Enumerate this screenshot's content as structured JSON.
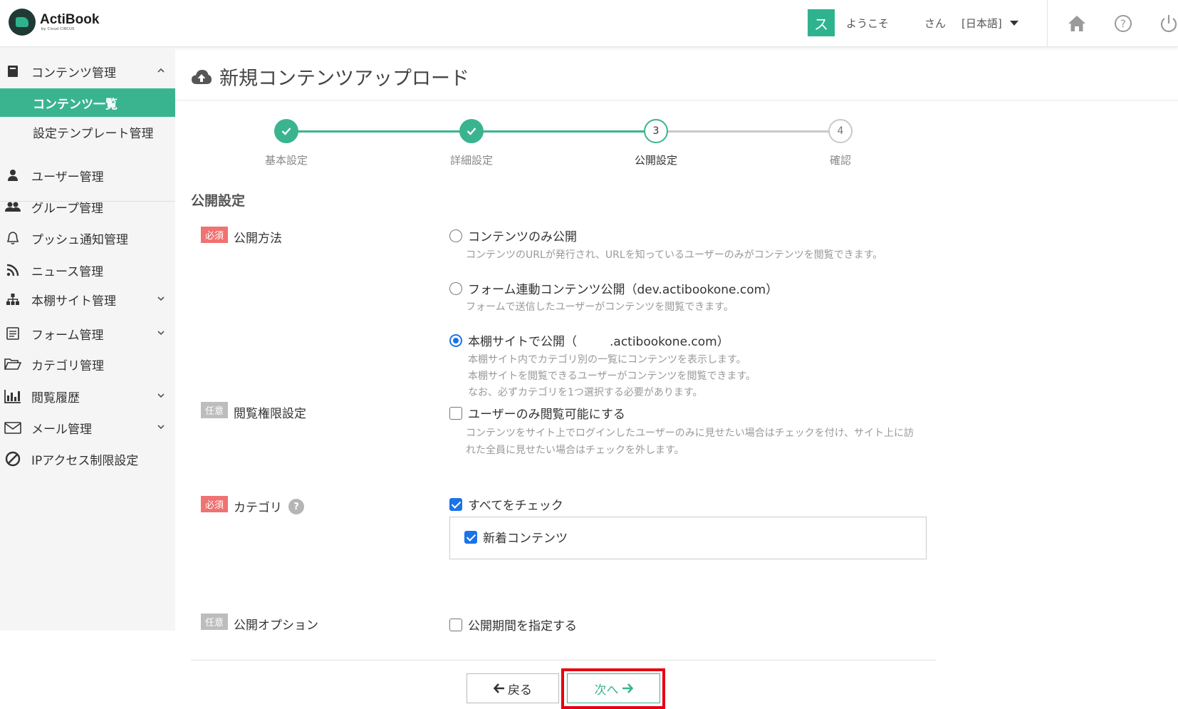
{
  "header": {
    "logo_title": "ActiBook",
    "logo_sub": "by Cloud CIRCUS",
    "user_initial": "ス",
    "welcome": "ようこそ",
    "san": "さん",
    "language": "[日本語]"
  },
  "sidebar": {
    "content_mgmt": "コンテンツ管理",
    "content_list": "コンテンツ一覧",
    "template_mgmt": "設定テンプレート管理",
    "user_mgmt": "ユーザー管理",
    "group_mgmt": "グループ管理",
    "push_mgmt": "プッシュ通知管理",
    "news_mgmt": "ニュース管理",
    "shelf_mgmt": "本棚サイト管理",
    "form_mgmt": "フォーム管理",
    "category_mgmt": "カテゴリ管理",
    "history": "閲覧履歴",
    "mail_mgmt": "メール管理",
    "ip_restrict": "IPアクセス制限設定"
  },
  "page": {
    "title": "新規コンテンツアップロード"
  },
  "stepper": {
    "steps": [
      {
        "label": "基本設定",
        "number": "1",
        "state": "done"
      },
      {
        "label": "詳細設定",
        "number": "2",
        "state": "done"
      },
      {
        "label": "公開設定",
        "number": "3",
        "state": "current"
      },
      {
        "label": "確認",
        "number": "4",
        "state": "todo"
      }
    ]
  },
  "form": {
    "section_title": "公開設定",
    "required_badge": "必須",
    "optional_badge": "任意",
    "publish_method": {
      "label": "公開方法",
      "options": [
        {
          "label": "コンテンツのみ公開",
          "help": "コンテンツのURLが発行され、URLを知っているユーザーのみがコンテンツを閲覧できます。",
          "selected": false
        },
        {
          "label": "フォーム連動コンテンツ公開（dev.actibookone.com）",
          "help": "フォームで送信したユーザーがコンテンツを閲覧できます。",
          "selected": false
        },
        {
          "label_prefix": "本棚サイトで公開（",
          "label_suffix": ".actibookone.com）",
          "help1": "本棚サイト内でカテゴリ別の一覧にコンテンツを表示します。",
          "help2": "本棚サイトを閲覧できるユーザーがコンテンツを閲覧できます。",
          "help3": "なお、必ずカテゴリを1つ選択する必要があります。",
          "selected": true
        }
      ]
    },
    "view_permission": {
      "label": "閲覧権限設定",
      "checkbox": "ユーザーのみ閲覧可能にする",
      "checked": false,
      "help1": "コンテンツをサイト上でログインしたユーザーのみに見せたい場合はチェックを付け、サイト上に訪",
      "help2": "れた全員に見せたい場合はチェックを外します。"
    },
    "category": {
      "label": "カテゴリ",
      "help_mark": "?",
      "check_all": "すべてをチェック",
      "check_all_checked": true,
      "items": [
        {
          "label": "新着コンテンツ",
          "checked": true
        }
      ]
    },
    "publish_option": {
      "label": "公開オプション",
      "checkbox": "公開期間を指定する",
      "checked": false
    }
  },
  "buttons": {
    "back": "戻る",
    "next": "次へ"
  },
  "colors": {
    "accent": "#3ab48f",
    "required": "#f07272",
    "optional": "#bdbdbd",
    "highlight": "#e60012",
    "check_blue": "#1a73e8"
  }
}
